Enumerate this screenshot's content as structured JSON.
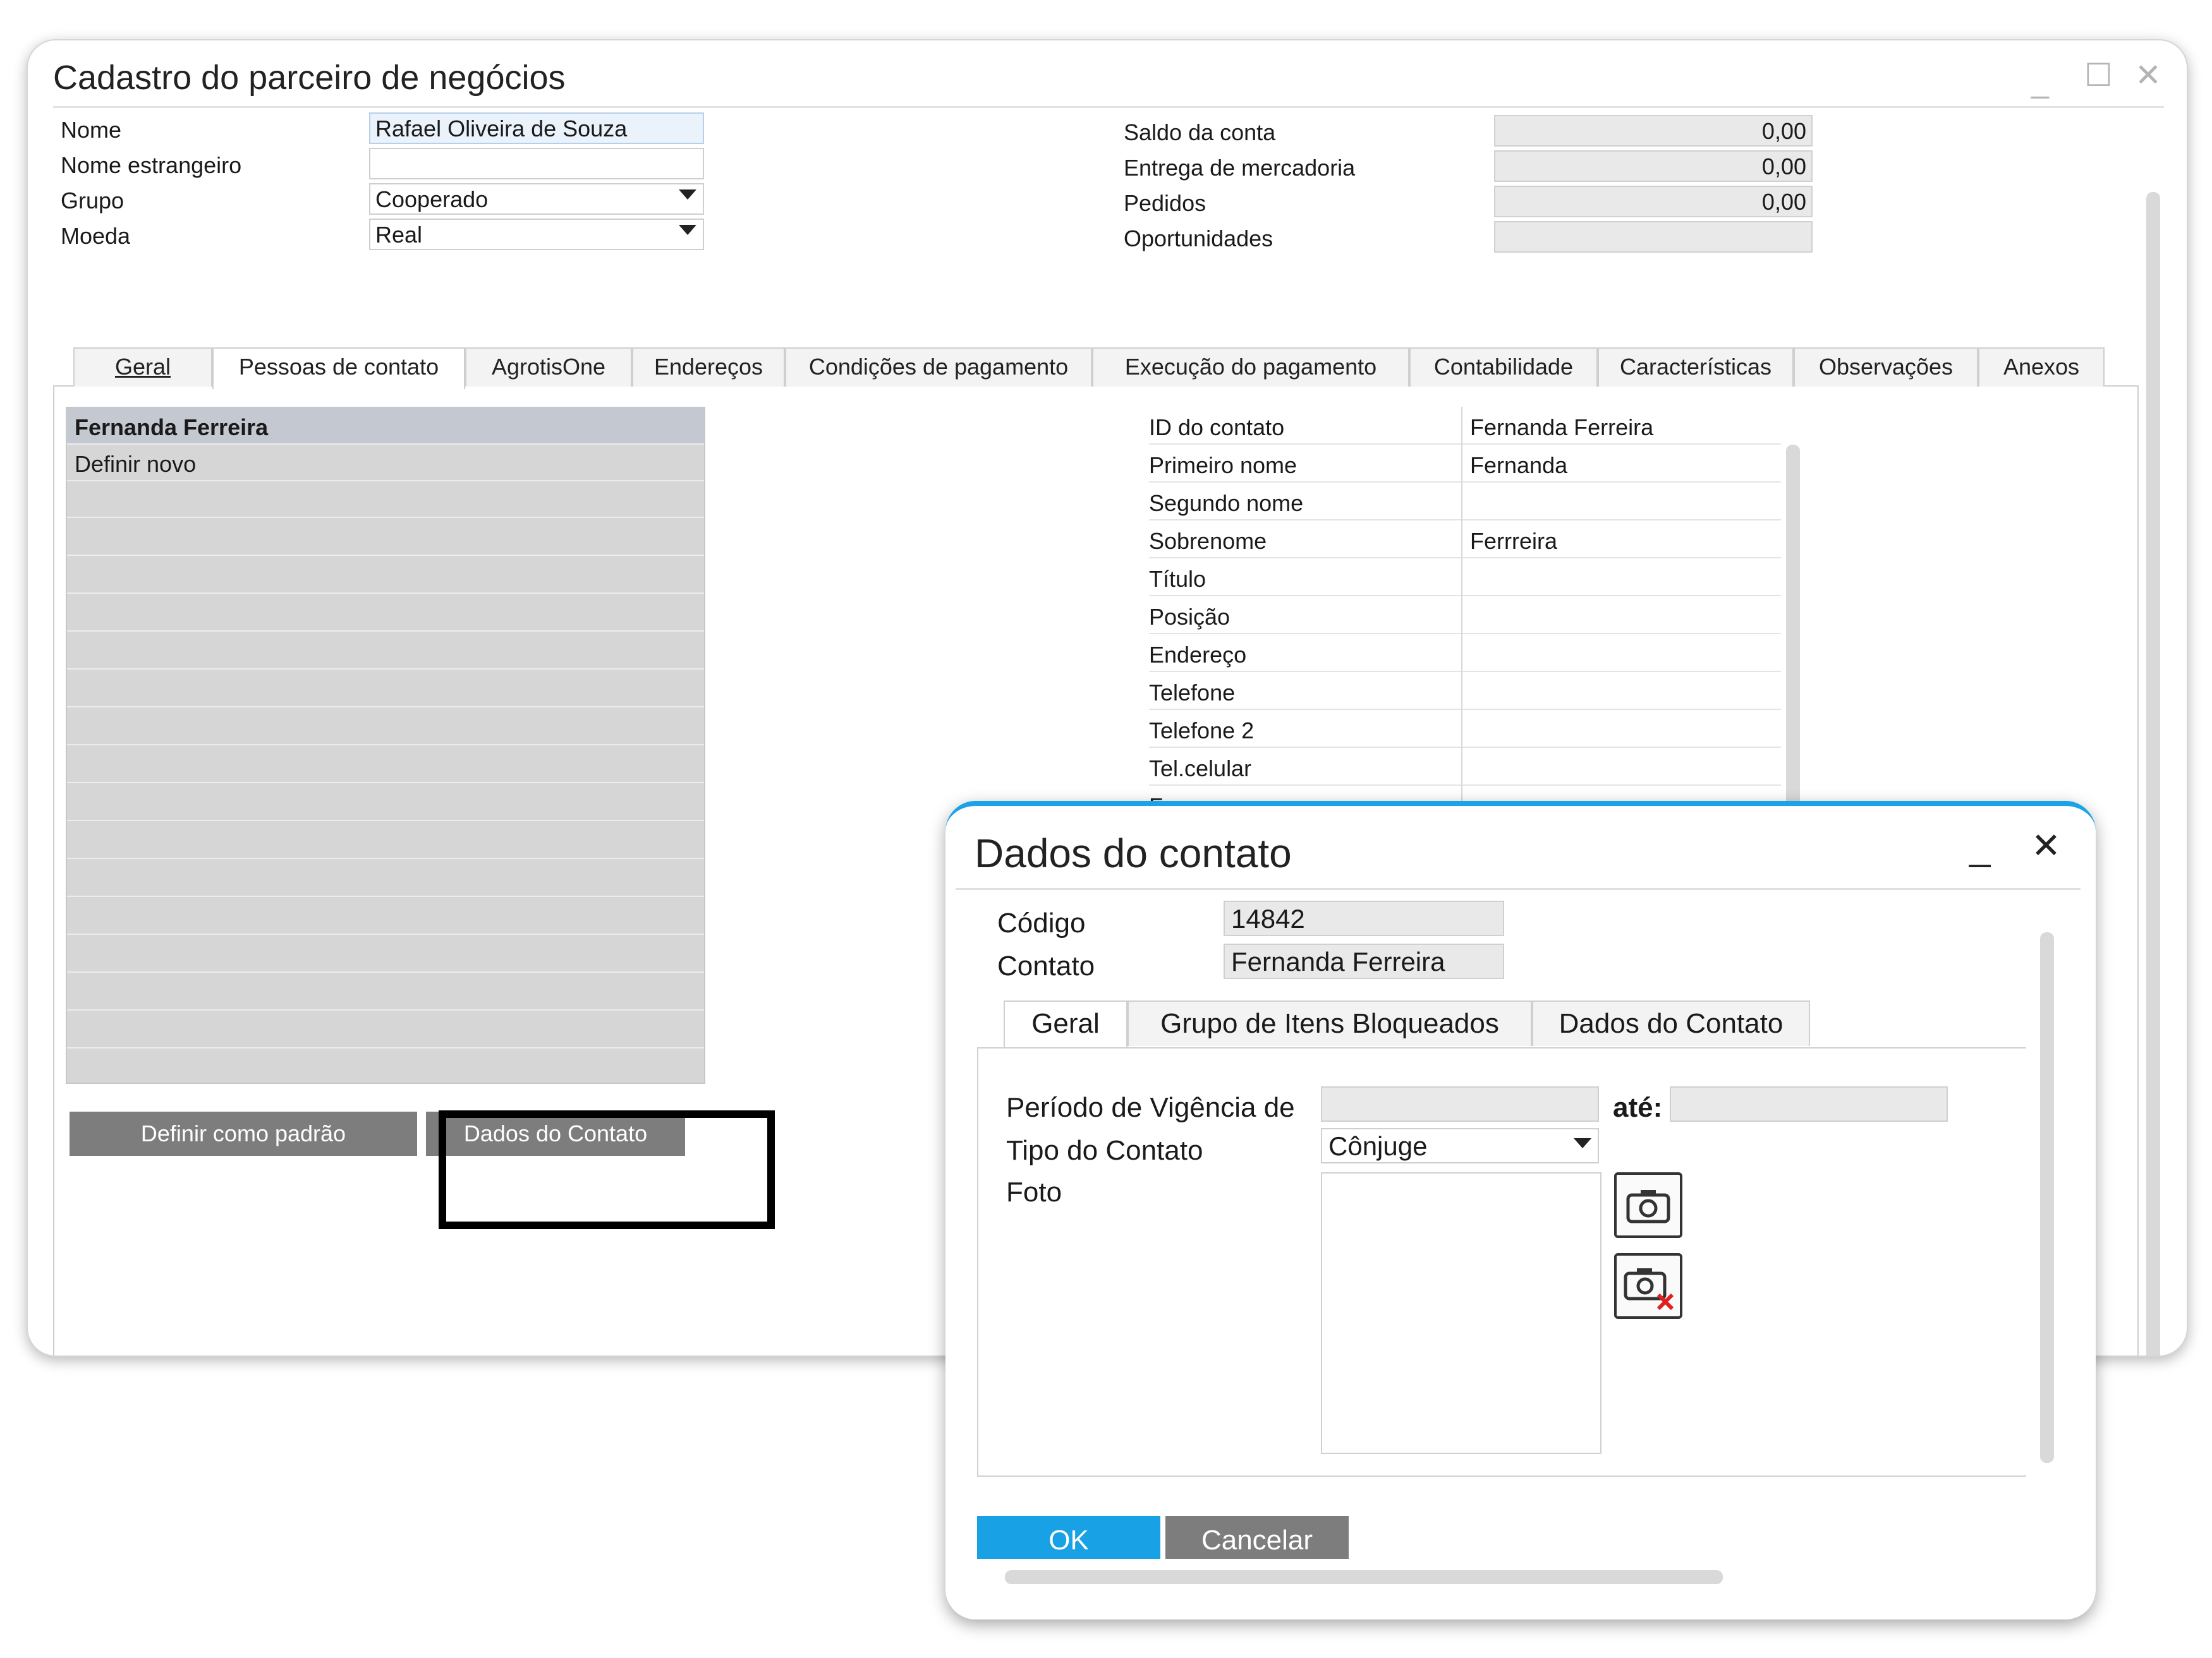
{
  "main_window": {
    "title": "Cadastro do parceiro de negócios",
    "controls": {
      "minimize": "_",
      "maximize": "☐",
      "close": "✕"
    },
    "header_left": {
      "nome_label": "Nome",
      "nome_value": "Rafael Oliveira de Souza",
      "nome_estrangeiro_label": "Nome estrangeiro",
      "nome_estrangeiro_value": "",
      "grupo_label": "Grupo",
      "grupo_value": "Cooperado",
      "moeda_label": "Moeda",
      "moeda_value": "Real"
    },
    "header_right": {
      "saldo_label": "Saldo da conta",
      "saldo_value": "0,00",
      "entrega_label": "Entrega de mercadoria",
      "entrega_value": "0,00",
      "pedidos_label": "Pedidos",
      "pedidos_value": "0,00",
      "oportunidades_label": "Oportunidades",
      "oportunidades_value": ""
    },
    "tabs": [
      {
        "label": "Geral"
      },
      {
        "label": "Pessoas de contato"
      },
      {
        "label": "AgrotisOne"
      },
      {
        "label": "Endereços"
      },
      {
        "label": "Condições de pagamento"
      },
      {
        "label": "Execução do pagamento"
      },
      {
        "label": "Contabilidade"
      },
      {
        "label": "Características"
      },
      {
        "label": "Observações"
      },
      {
        "label": "Anexos"
      }
    ],
    "contacts": [
      "Fernanda Ferreira",
      "Definir novo"
    ],
    "buttons": {
      "set_default": "Definir como padrão",
      "contact_data": "Dados do Contato"
    },
    "details": [
      {
        "label": "ID do contato",
        "value": "Fernanda Ferreira"
      },
      {
        "label": "Primeiro nome",
        "value": "Fernanda"
      },
      {
        "label": "Segundo nome",
        "value": ""
      },
      {
        "label": "Sobrenome",
        "value": "Ferrreira"
      },
      {
        "label": "Título",
        "value": ""
      },
      {
        "label": "Posição",
        "value": ""
      },
      {
        "label": "Endereço",
        "value": ""
      },
      {
        "label": "Telefone",
        "value": ""
      },
      {
        "label": "Telefone 2",
        "value": ""
      },
      {
        "label": "Tel.celular",
        "value": ""
      },
      {
        "label": "Fax",
        "value": ""
      }
    ]
  },
  "dialog": {
    "title": "Dados do contato",
    "controls": {
      "minimize": "_",
      "close": "✕"
    },
    "codigo_label": "Código",
    "codigo_value": "14842",
    "contato_label": "Contato",
    "contato_value": "Fernanda Ferreira",
    "tabs": [
      {
        "label": "Geral"
      },
      {
        "label": "Grupo de Itens Bloqueados"
      },
      {
        "label": "Dados do Contato"
      }
    ],
    "periodo_label": "Período de Vigência de",
    "periodo_from": "",
    "ate_label": "até:",
    "periodo_to": "",
    "tipo_label": "Tipo do Contato",
    "tipo_value": "Cônjuge",
    "foto_label": "Foto",
    "ok": "OK",
    "cancel": "Cancelar",
    "accent": "#1aa3e8"
  }
}
